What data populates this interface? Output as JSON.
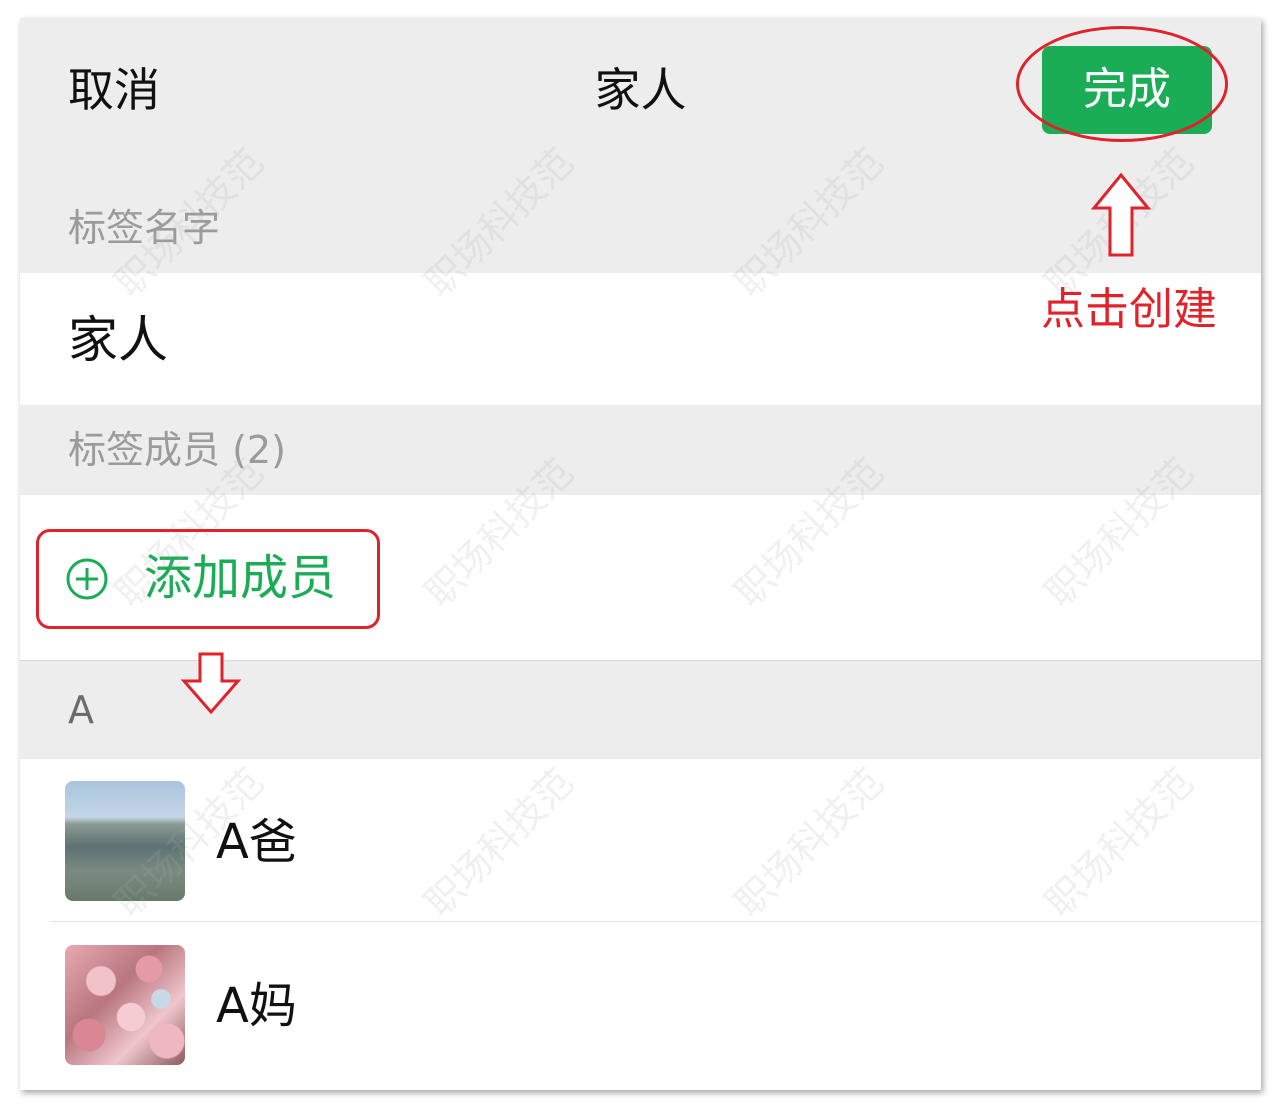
{
  "header": {
    "cancel_label": "取消",
    "title": "家人",
    "done_label": "完成"
  },
  "tag_name": {
    "section_label": "标签名字",
    "value": "家人"
  },
  "members": {
    "section_label": "标签成员 (2)",
    "add_label": "添加成员",
    "index_letter": "A",
    "contacts": [
      {
        "name": "A爸",
        "avatar": "lake-photo"
      },
      {
        "name": "A妈",
        "avatar": "blossom-photo"
      }
    ]
  },
  "annotation": {
    "text": "点击创建",
    "color": "#e0222a"
  },
  "watermark": "职场科技范",
  "colors": {
    "accent_green": "#1aad56",
    "background_gray": "#ededed"
  },
  "icons": {
    "add": "plus-circle-icon"
  }
}
